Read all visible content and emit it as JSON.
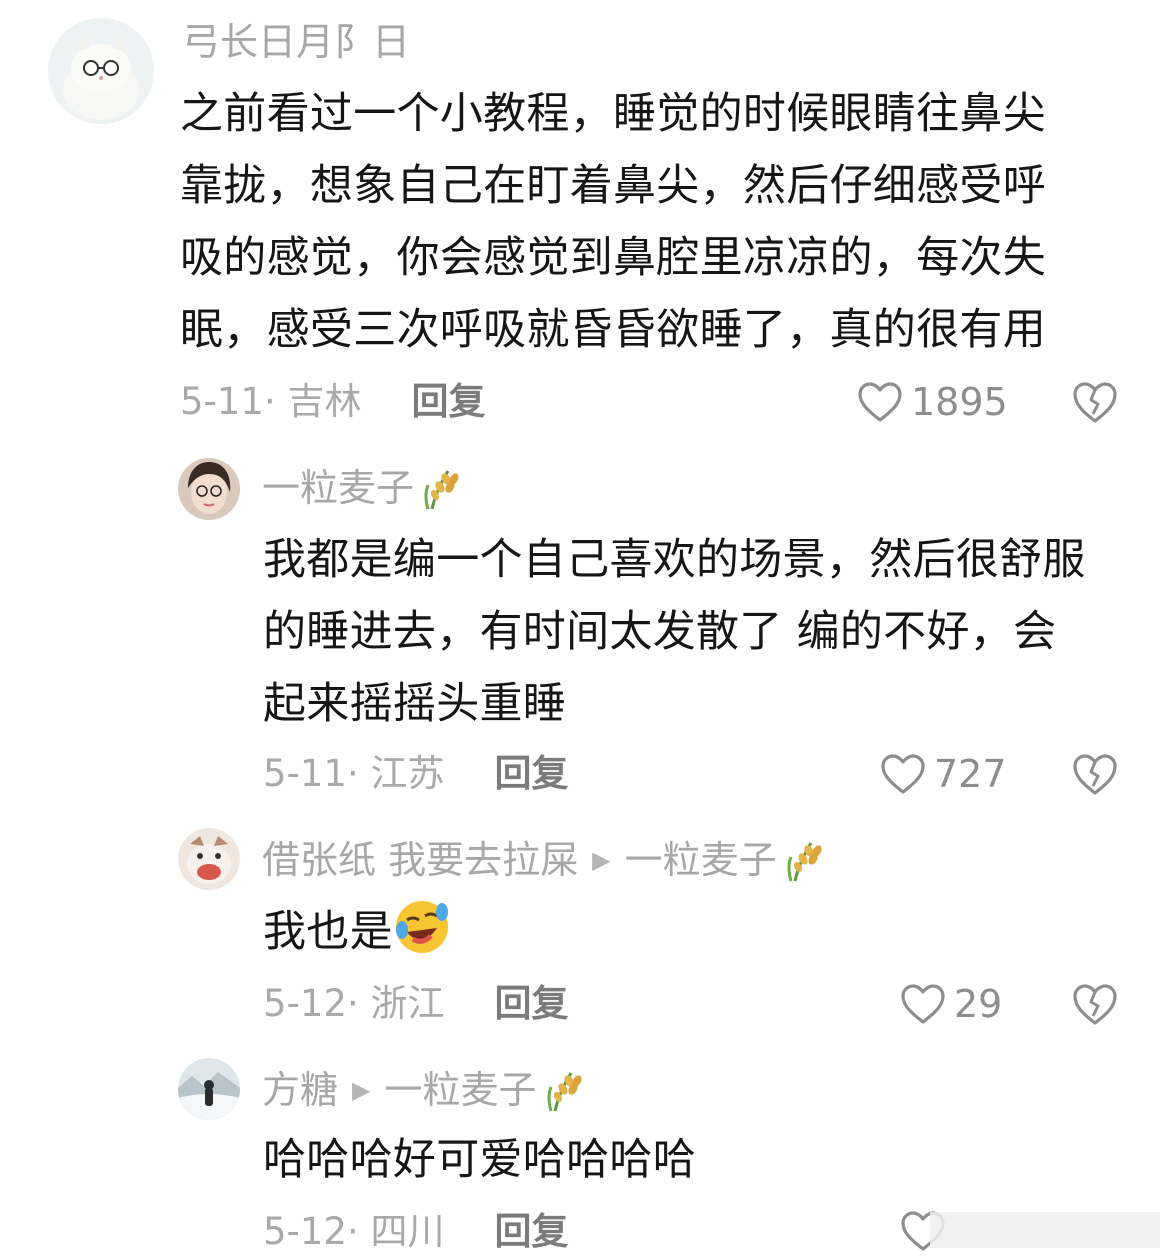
{
  "comments": [
    {
      "author": "弓长日月阝日",
      "text_lines": [
        "之前看过一个小教程，睡觉的时候眼睛往鼻尖",
        "靠拢，想象自己在盯着鼻尖，然后仔细感受呼",
        "吸的感觉，你会感觉到鼻腔里凉凉的，每次失",
        "眠，感受三次呼吸就昏昏欲睡了，真的很有用"
      ],
      "meta": "5-11· 吉林",
      "reply": "回复",
      "likes": "1895"
    },
    {
      "author": "一粒麦子",
      "text_lines": [
        "我都是编一个自己喜欢的场景，然后很舒服",
        "的睡进去，有时间太发散了 编的不好，会",
        "起来摇摇头重睡"
      ],
      "meta": "5-11· 江苏",
      "reply": "回复",
      "likes": "727"
    },
    {
      "author": "借张纸 我要去拉屎",
      "reply_to": "一粒麦子",
      "text": "我也是",
      "meta": "5-12· 浙江",
      "reply": "回复",
      "likes": "29"
    },
    {
      "author": "方糖",
      "reply_to": "一粒麦子",
      "text": "哈哈哈好可爱哈哈哈哈",
      "meta": "5-12· 四川",
      "reply": "回复"
    }
  ],
  "icons": {
    "like": "heart-outline-icon",
    "dislike": "broken-heart-icon",
    "reply_arrow": "triangle-right-icon",
    "name_emoji": "rice-ear-emoji",
    "text_emoji": "rolling-laughing-emoji"
  }
}
